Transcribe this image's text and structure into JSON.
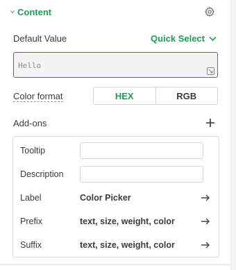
{
  "section": {
    "title": "Content"
  },
  "default_value": {
    "label": "Default Value",
    "quick_select_label": "Quick Select",
    "input_value": "Hello"
  },
  "color_format": {
    "label": "Color format",
    "options": [
      "HEX",
      "RGB"
    ],
    "selected": "HEX"
  },
  "addons": {
    "label": "Add-ons",
    "rows": [
      {
        "label": "Tooltip",
        "value": ""
      },
      {
        "label": "Description",
        "value": ""
      },
      {
        "label": "Label",
        "value": "Color Picker"
      },
      {
        "label": "Prefix",
        "value": "text, size, weight, color"
      },
      {
        "label": "Suffix",
        "value": "text, size, weight, color"
      }
    ]
  },
  "colors": {
    "accent_green": "#1f9d55",
    "focus_purple": "#8e44ad",
    "text": "#3b3b3b"
  },
  "icons": {
    "collapse": "caret-down-icon",
    "settings": "gear-icon",
    "dropdown": "chevron-down-icon",
    "resize": "resize-icon",
    "add": "plus-icon",
    "navigate": "arrow-right-icon"
  }
}
